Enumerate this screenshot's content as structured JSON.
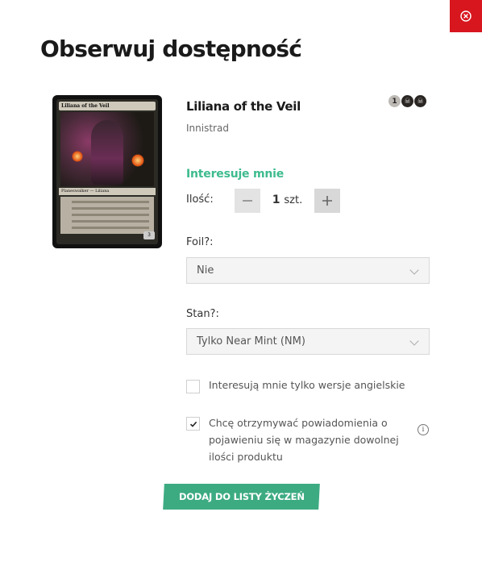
{
  "modal": {
    "title": "Obserwuj dostępność",
    "close_icon": "close-icon"
  },
  "product": {
    "name": "Liliana of the Veil",
    "set": "Innistrad",
    "card_image": {
      "card_title": "Liliana of the Veil",
      "type_line": "Planeswalker — Liliana",
      "loyalty": "3"
    },
    "mana_cost": [
      "1",
      "B",
      "B"
    ]
  },
  "form": {
    "section_label": "Interesuje mnie",
    "quantity": {
      "label": "Ilość:",
      "value": "1",
      "unit": "szt."
    },
    "foil": {
      "label": "Foil?:",
      "selected": "Nie"
    },
    "condition": {
      "label": "Stan?:",
      "selected": "Tylko Near Mint (NM)"
    },
    "english_only": {
      "label": "Interesują mnie tylko wersje angielskie",
      "checked": false
    },
    "notifications": {
      "line1": "Chcę otrzymywać powiadomienia o",
      "line2": "pojawieniu się w magazynie dowolnej",
      "line3": "ilości produktu",
      "checked": true
    },
    "submit_label": "DODAJ DO LISTY ŻYCZEŃ"
  },
  "colors": {
    "close_bg": "#d8161e",
    "accent_green": "#3dbb8e",
    "button_green": "#3dab82"
  }
}
